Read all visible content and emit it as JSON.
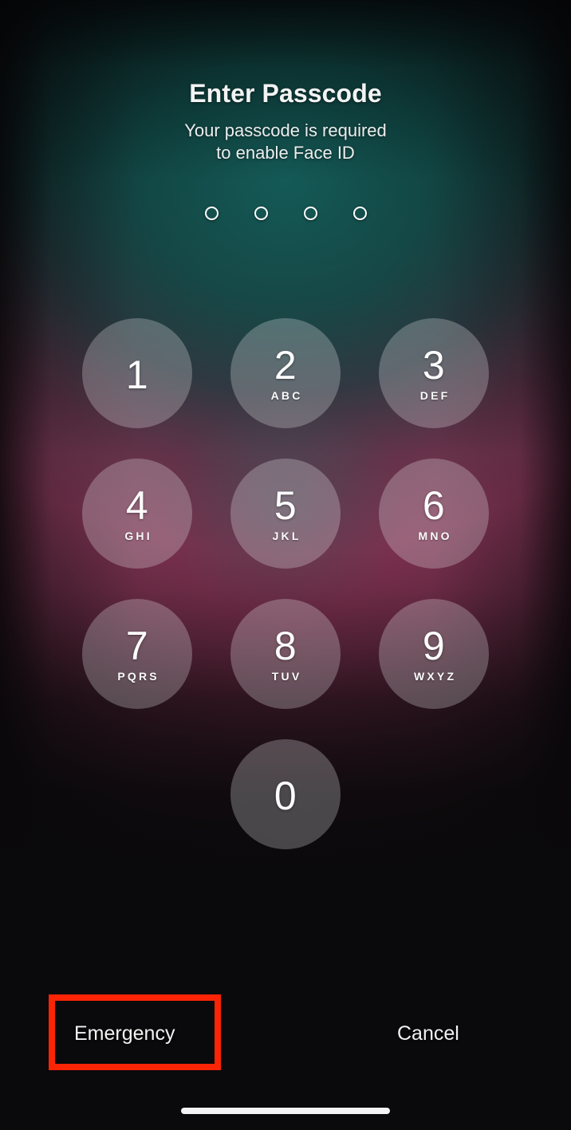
{
  "screen": {
    "title": "Enter Passcode",
    "subtitle_line1": "Your passcode is required",
    "subtitle_line2": "to enable Face ID"
  },
  "passcode_field": {
    "length": 4,
    "entered": 0,
    "dots": [
      {
        "name": "passcode-dot-1",
        "filled": false
      },
      {
        "name": "passcode-dot-2",
        "filled": false
      },
      {
        "name": "passcode-dot-3",
        "filled": false
      },
      {
        "name": "passcode-dot-4",
        "filled": false
      }
    ]
  },
  "keypad": {
    "rows": [
      [
        {
          "digit": "1",
          "letters": ""
        },
        {
          "digit": "2",
          "letters": "ABC"
        },
        {
          "digit": "3",
          "letters": "DEF"
        }
      ],
      [
        {
          "digit": "4",
          "letters": "GHI"
        },
        {
          "digit": "5",
          "letters": "JKL"
        },
        {
          "digit": "6",
          "letters": "MNO"
        }
      ],
      [
        {
          "digit": "7",
          "letters": "PQRS"
        },
        {
          "digit": "8",
          "letters": "TUV"
        },
        {
          "digit": "9",
          "letters": "WXYZ"
        }
      ],
      [
        {
          "digit": "0",
          "letters": ""
        }
      ]
    ]
  },
  "footer": {
    "emergency_label": "Emergency",
    "cancel_label": "Cancel"
  },
  "annotation": {
    "target": "Emergency",
    "color": "#fb2405"
  },
  "colors": {
    "teal_glow": "#0d4a46",
    "teal_dark": "#0d3f3f",
    "rose_band": "#9b3f66",
    "plum_edge": "#8e3f5e",
    "screen_black": "#0a090b",
    "key_fill": "rgba(238,238,240,0.27)",
    "text_white": "#f2f3f3",
    "home_indicator": "#f4f4f5"
  }
}
